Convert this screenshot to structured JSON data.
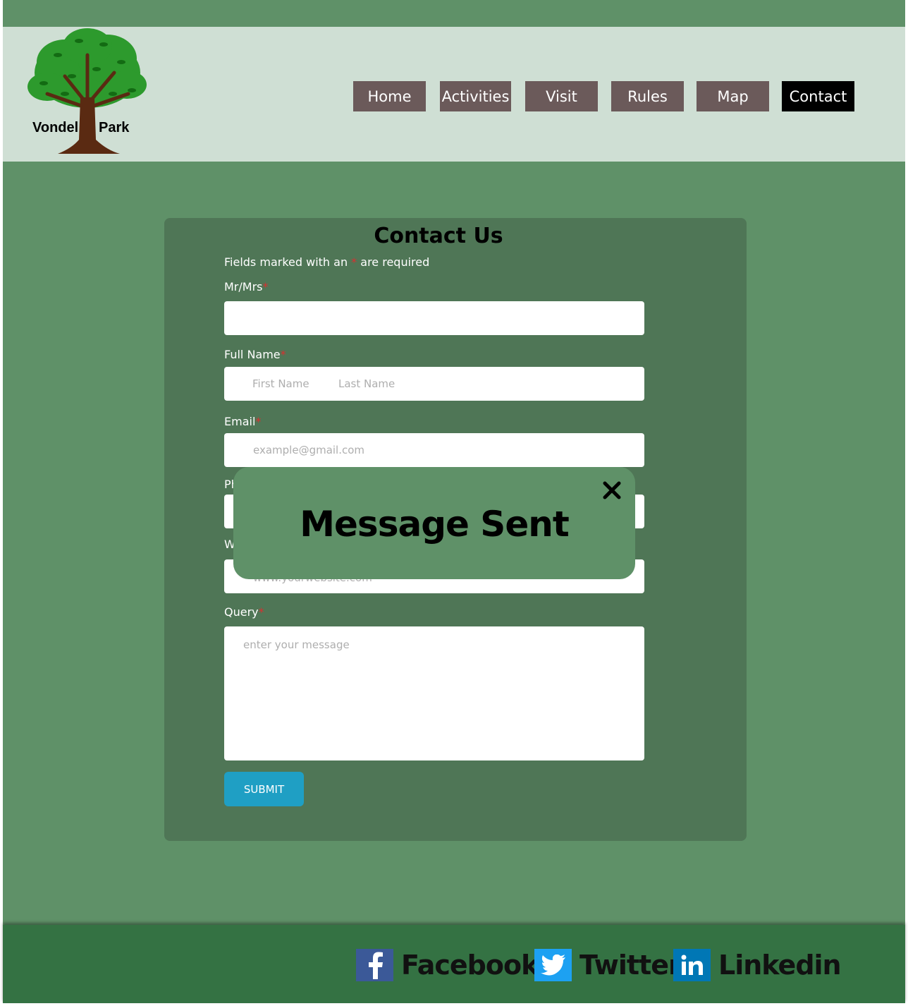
{
  "logo": {
    "left_word": "Vondel",
    "right_word": "Park"
  },
  "nav": {
    "items": [
      "Home",
      "Activities",
      "Visit",
      "Rules",
      "Map",
      "Contact"
    ],
    "active": "Contact"
  },
  "form": {
    "title": "Contact Us",
    "note_prefix": "Fields marked with an",
    "note_star": "*",
    "note_suffix": "are required",
    "required_star": "*",
    "title_label": "Mr/Mrs",
    "name_label": "Full Name",
    "first_name_placeholder": "First Name",
    "last_name_placeholder": "Last Name",
    "email_label": "Email",
    "email_placeholder": "example@gmail.com",
    "phone_label_visible": "Ph",
    "website_label_visible": "W",
    "website_placeholder": "www.yourwebsite.com",
    "query_label": "Query",
    "query_placeholder": "enter your message",
    "submit_label": "SUBMIT"
  },
  "modal": {
    "title": "Message Sent",
    "close_glyph": "✕"
  },
  "footer": {
    "facebook": "Facebook",
    "twitter": "Twitter",
    "linkedin": "Linkedin",
    "colors": {
      "facebook": "#3b5998",
      "twitter": "#1da1f2",
      "linkedin": "#0077b5"
    }
  },
  "colors": {
    "page_bg": "#5f9168",
    "header_bg": "#cfdfd4",
    "card_bg": "#4f7656",
    "nav_bg": "#6b5a5a",
    "nav_active_bg": "#000000",
    "submit_bg": "#1f9fc4",
    "footer_bg": "#347243"
  }
}
